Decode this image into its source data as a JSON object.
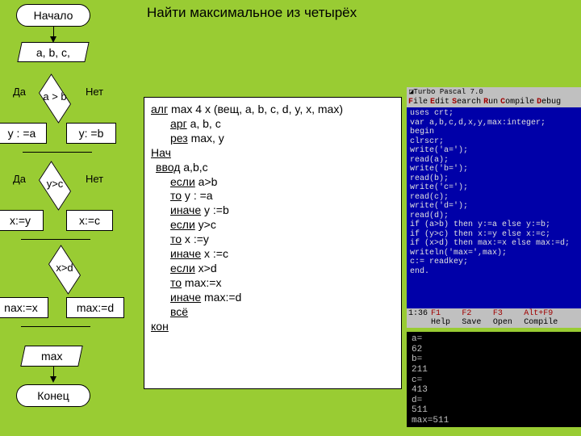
{
  "title": "Найти максимальное из четырёх",
  "flow": {
    "start": "Начало",
    "io1": "a, b, c,",
    "d1": "a > b",
    "d1_yes": "Да",
    "d1_no": "Нет",
    "p1a": "y : =a",
    "p1b": "y: =b",
    "d2": "y>c",
    "d2_yes": "Да",
    "d2_no": "Нет",
    "p2a": "x:=y",
    "p2b": "x:=c",
    "d3": "x>d",
    "p3a": "nax:=x",
    "p3b": "max:=d",
    "out": "max",
    "end": "Конец"
  },
  "algo": {
    "l1_u": "алг",
    "l1_r": "   max 4 x (вещ, a, b, c, d, y, x, max)",
    "l2_u": "арг",
    "l2_r": " a, b, с",
    "l3_u": "рез",
    "l3_r": " max, y",
    "l4_u": "Нач",
    "l5_u": "ввод",
    "l5_r": " a,b,c",
    "l6_u": "если",
    "l6_r": " a>b",
    "l7_u": "то",
    "l7_r": " y : =a",
    "l8_u": "иначе",
    "l8_r": " y :=b",
    "l9_u": "если",
    "l9_r": " y>c",
    "l10_u": "то",
    "l10_r": " x :=y",
    "l11_u": "иначе",
    "l11_r": " x :=c",
    "l12_u": "если",
    "l12_r": " x>d",
    "l13_u": "то",
    "l13_r": " max:=x",
    "l14_u": "иначе",
    "l14_r": " max:=d",
    "l15_u": "всё",
    "l16_u": "кон"
  },
  "ide": {
    "title_icon": "◪",
    "title": "Turbo Pascal 7.0",
    "menu": [
      "File",
      "Edit",
      "Search",
      "Run",
      "Compile",
      "Debug"
    ],
    "code": "uses crt;\nvar a,b,c,d,x,y,max:integer;\nbegin\nclrscr;\nwrite('a=');\nread(a);\nwrite('b=');\nread(b);\nwrite('c=');\nread(c);\nwrite('d=');\nread(d);\nif (a>b) then y:=a else y:=b;\nif (y>c) then x:=y else x:=c;\nif (x>d) then max:=x else max:=d;\nwriteln('max=',max);\nc:= readkey;\nend.",
    "status_pos": "1:36",
    "status_keys": [
      {
        "k": "F1",
        "t": "Help"
      },
      {
        "k": "F2",
        "t": "Save"
      },
      {
        "k": "F3",
        "t": "Open"
      },
      {
        "k": "Alt+F9",
        "t": "Compile"
      }
    ]
  },
  "console_lines": [
    "a=",
    "62",
    "b=",
    "211",
    "c=",
    "413",
    "d=",
    "511",
    "max=511"
  ]
}
